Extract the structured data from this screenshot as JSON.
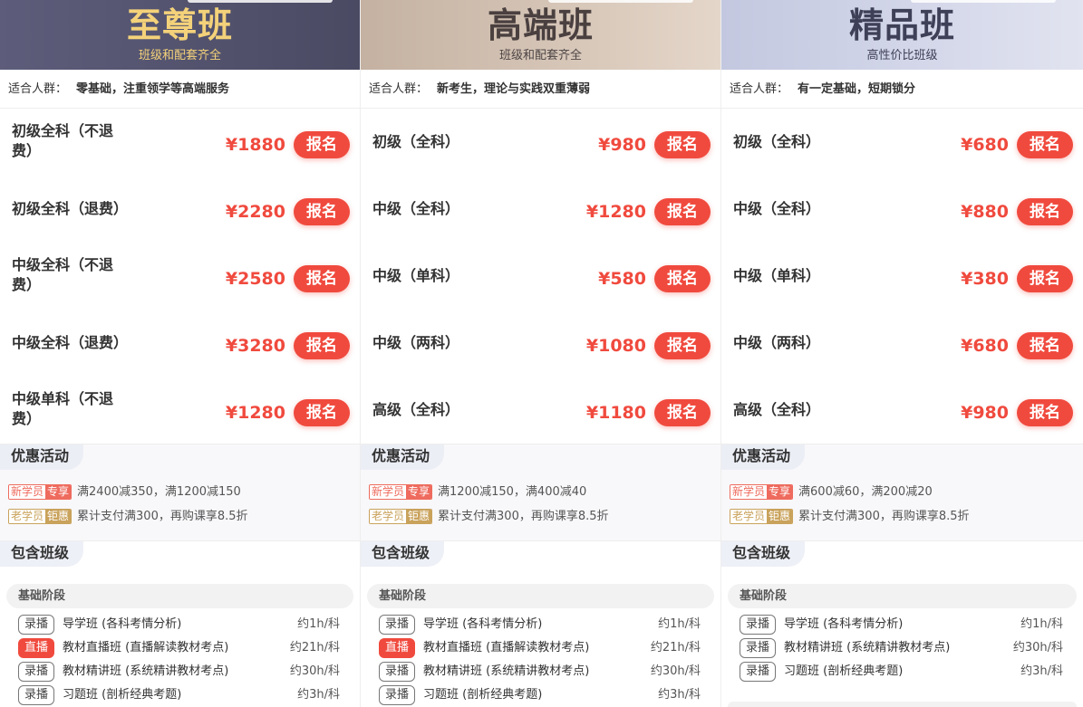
{
  "columns": [
    {
      "title": "至尊班",
      "subtitle": "班级和配套齐全",
      "audience_label": "适合人群：",
      "audience": "零基础，注重领学等高端服务",
      "plans": [
        {
          "name": "初级全科（不退费）",
          "price": "¥1880",
          "button": "报名"
        },
        {
          "name": "初级全科（退费）",
          "price": "¥2280",
          "button": "报名"
        },
        {
          "name": "中级全科（不退费）",
          "price": "¥2580",
          "button": "报名"
        },
        {
          "name": "中级全科（退费）",
          "price": "¥3280",
          "button": "报名"
        },
        {
          "name": "中级单科（不退费）",
          "price": "¥1280",
          "button": "报名"
        }
      ],
      "promo_title": "优惠活动",
      "promos": [
        {
          "tag_a": "新学员",
          "tag_b": "专享",
          "text": "满2400减350，满1200减150"
        },
        {
          "tag_a": "老学员",
          "tag_b": "钜惠",
          "text": "累计支付满300，再购课享8.5折"
        }
      ],
      "includes_title": "包含班级",
      "stage": "基础阶段",
      "courses": [
        {
          "kind": "录播",
          "name": "导学班 (各科考情分析)",
          "hours": "约1h/科"
        },
        {
          "kind": "直播",
          "name": "教材直播班 (直播解读教材考点)",
          "hours": "约21h/科"
        },
        {
          "kind": "录播",
          "name": "教材精讲班 (系统精讲教材考点)",
          "hours": "约30h/科"
        },
        {
          "kind": "录播",
          "name": "习题班 (剖析经典考题)",
          "hours": "约3h/科"
        }
      ]
    },
    {
      "title": "高端班",
      "subtitle": "班级和配套齐全",
      "audience_label": "适合人群：",
      "audience": "新考生，理论与实践双重薄弱",
      "plans": [
        {
          "name": "初级（全科）",
          "price": "¥980",
          "button": "报名"
        },
        {
          "name": "中级（全科）",
          "price": "¥1280",
          "button": "报名"
        },
        {
          "name": "中级（单科）",
          "price": "¥580",
          "button": "报名"
        },
        {
          "name": "中级（两科）",
          "price": "¥1080",
          "button": "报名"
        },
        {
          "name": "高级（全科）",
          "price": "¥1180",
          "button": "报名"
        }
      ],
      "promo_title": "优惠活动",
      "promos": [
        {
          "tag_a": "新学员",
          "tag_b": "专享",
          "text": "满1200减150，满400减40"
        },
        {
          "tag_a": "老学员",
          "tag_b": "钜惠",
          "text": "累计支付满300，再购课享8.5折"
        }
      ],
      "includes_title": "包含班级",
      "stage": "基础阶段",
      "courses": [
        {
          "kind": "录播",
          "name": "导学班 (各科考情分析)",
          "hours": "约1h/科"
        },
        {
          "kind": "直播",
          "name": "教材直播班 (直播解读教材考点)",
          "hours": "约21h/科"
        },
        {
          "kind": "录播",
          "name": "教材精讲班 (系统精讲教材考点)",
          "hours": "约30h/科"
        },
        {
          "kind": "录播",
          "name": "习题班 (剖析经典考题)",
          "hours": "约3h/科"
        }
      ]
    },
    {
      "title": "精品班",
      "subtitle": "高性价比班级",
      "audience_label": "适合人群：",
      "audience": "有一定基础，短期锁分",
      "plans": [
        {
          "name": "初级（全科）",
          "price": "¥680",
          "button": "报名"
        },
        {
          "name": "中级（全科）",
          "price": "¥880",
          "button": "报名"
        },
        {
          "name": "中级（单科）",
          "price": "¥380",
          "button": "报名"
        },
        {
          "name": "中级（两科）",
          "price": "¥680",
          "button": "报名"
        },
        {
          "name": "高级（全科）",
          "price": "¥980",
          "button": "报名"
        }
      ],
      "promo_title": "优惠活动",
      "promos": [
        {
          "tag_a": "新学员",
          "tag_b": "专享",
          "text": "满600减60，满200减20"
        },
        {
          "tag_a": "老学员",
          "tag_b": "钜惠",
          "text": "累计支付满300，再购课享8.5折"
        }
      ],
      "includes_title": "包含班级",
      "stage": "基础阶段",
      "courses": [
        {
          "kind": "录播",
          "name": "导学班 (各科考情分析)",
          "hours": "约1h/科"
        },
        {
          "kind": "录播",
          "name": "教材精讲班 (系统精讲教材考点)",
          "hours": "约30h/科"
        },
        {
          "kind": "录播",
          "name": "习题班 (剖析经典考题)",
          "hours": "约3h/科"
        }
      ]
    }
  ]
}
